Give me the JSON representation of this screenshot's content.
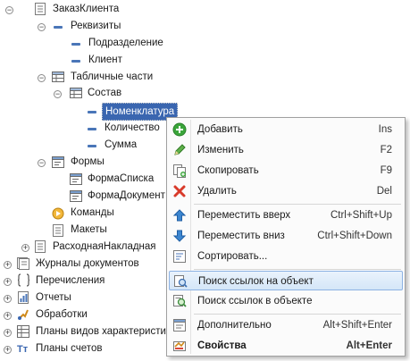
{
  "tree": {
    "items": [
      {
        "label": "ЗаказКлиента"
      },
      {
        "label": "Реквизиты"
      },
      {
        "label": "Подразделение"
      },
      {
        "label": "Клиент"
      },
      {
        "label": "Табличные части"
      },
      {
        "label": "Состав"
      },
      {
        "label": "Номенклатура"
      },
      {
        "label": "Количество"
      },
      {
        "label": "Сумма"
      },
      {
        "label": "Формы"
      },
      {
        "label": "ФормаСписка"
      },
      {
        "label": "ФормаДокумент"
      },
      {
        "label": "Команды"
      },
      {
        "label": "Макеты"
      },
      {
        "label": "РасходнаяНакладная"
      },
      {
        "label": "Журналы документов"
      },
      {
        "label": "Перечисления"
      },
      {
        "label": "Отчеты"
      },
      {
        "label": "Обработки"
      },
      {
        "label": "Планы видов характеристик"
      },
      {
        "label": "Планы счетов"
      }
    ]
  },
  "context_menu": {
    "items": [
      {
        "label": "Добавить",
        "shortcut": "Ins",
        "icon": "add-icon"
      },
      {
        "label": "Изменить",
        "shortcut": "F2",
        "icon": "edit-pencil-icon"
      },
      {
        "label": "Скопировать",
        "shortcut": "F9",
        "icon": "copy-icon"
      },
      {
        "label": "Удалить",
        "shortcut": "Del",
        "icon": "delete-x-icon"
      },
      {
        "label": "Переместить вверх",
        "shortcut": "Ctrl+Shift+Up",
        "icon": "arrow-up-icon"
      },
      {
        "label": "Переместить вниз",
        "shortcut": "Ctrl+Shift+Down",
        "icon": "arrow-down-icon"
      },
      {
        "label": "Сортировать...",
        "shortcut": "",
        "icon": "sort-icon"
      },
      {
        "label": "Поиск ссылок на объект",
        "shortcut": "",
        "icon": "find-references-icon"
      },
      {
        "label": "Поиск ссылок в объекте",
        "shortcut": "",
        "icon": "find-in-object-icon"
      },
      {
        "label": "Дополнительно",
        "shortcut": "Alt+Shift+Enter",
        "icon": "additional-icon"
      },
      {
        "label": "Свойства",
        "shortcut": "Alt+Enter",
        "icon": "properties-icon"
      }
    ]
  },
  "colors": {
    "selection": "#3a66b0",
    "menu_highlight": "#d4e6f8",
    "add_green": "#3aa53a",
    "delete_red": "#d83a2a",
    "arrow_blue": "#3c86d0"
  }
}
